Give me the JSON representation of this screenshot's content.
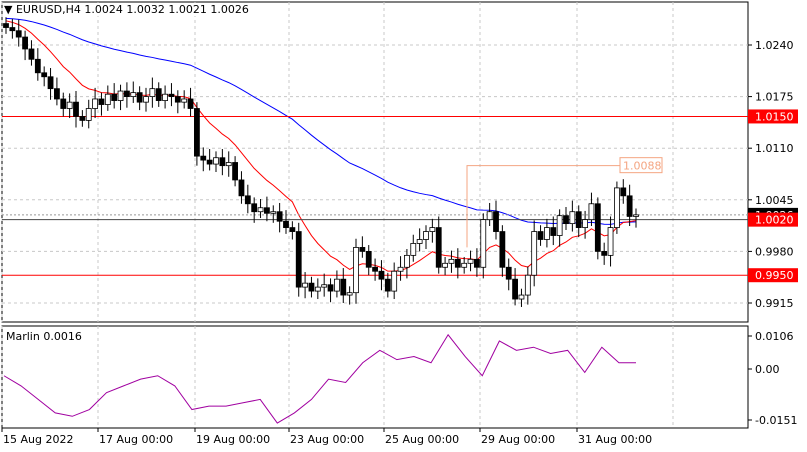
{
  "header": {
    "symbol": "EURUSD,H4",
    "open": "1.0024",
    "high": "1.0032",
    "low": "1.0021",
    "close": "1.0026"
  },
  "price_axis": [
    "1.0240",
    "1.0175",
    "1.0110",
    "1.0045",
    "0.9980",
    "0.9915"
  ],
  "price_axis_values": [
    1.024,
    1.0175,
    1.011,
    1.0045,
    0.998,
    0.9915
  ],
  "levels": [
    {
      "value": 1.015,
      "label": "1.0150",
      "color": "#ff0000"
    },
    {
      "value": 0.995,
      "label": "0.9950",
      "color": "#ff0000"
    },
    {
      "value": 1.002,
      "label": "1.0020",
      "color": "#ff0000"
    }
  ],
  "current_price": {
    "value": 1.0026,
    "label": "1.0026"
  },
  "annotation": {
    "value": 1.0088,
    "label": "1.0088",
    "color": "#f4a582"
  },
  "indicator": {
    "name": "Marlin",
    "value": "0.0016",
    "axis": [
      "0.0106",
      "0.00",
      "-0.0151"
    ],
    "axis_values": [
      0.0106,
      0,
      -0.0151
    ],
    "values": [
      -0.002,
      -0.005,
      -0.009,
      -0.013,
      -0.014,
      -0.012,
      -0.007,
      -0.005,
      -0.003,
      -0.002,
      -0.005,
      -0.012,
      -0.011,
      -0.011,
      -0.01,
      -0.009,
      -0.016,
      -0.013,
      -0.009,
      -0.003,
      -0.004,
      0.002,
      0.006,
      0.003,
      0.004,
      0.002,
      0.011,
      0.004,
      -0.002,
      0.009,
      0.006,
      0.007,
      0.005,
      0.006,
      -0.001,
      0.007,
      0.002,
      0.002
    ]
  },
  "time_axis": [
    "15 Aug 2022",
    "17 Aug 00:00",
    "19 Aug 00:00",
    "23 Aug 00:00",
    "25 Aug 00:00",
    "29 Aug 00:00",
    "31 Aug 00:00"
  ],
  "closes_pips": [
    262,
    258,
    250,
    235,
    222,
    205,
    200,
    185,
    172,
    160,
    168,
    150,
    145,
    160,
    172,
    165,
    178,
    170,
    182,
    175,
    180,
    168,
    175,
    185,
    170,
    178,
    175,
    168,
    172,
    160,
    100,
    95,
    90,
    98,
    88,
    92,
    70,
    50,
    40,
    30,
    35,
    28,
    30,
    18,
    10,
    5,
    -65,
    -60,
    -70,
    -65,
    -62,
    -70,
    -55,
    -75,
    -72,
    -15,
    -20,
    -40,
    -45,
    -55,
    -70,
    -45,
    -40,
    -25,
    -10,
    -5,
    5,
    10,
    -40,
    -35,
    -30,
    -40,
    -35,
    -30,
    -40,
    20,
    30,
    5,
    -40,
    -55,
    -80,
    -75,
    -50,
    5,
    -5,
    10,
    0,
    25,
    15,
    30,
    10,
    20,
    40,
    -20,
    -25,
    10,
    60,
    50,
    24,
    26
  ],
  "colors": {
    "bg": "#ffffff",
    "grid": "#c8c8c8",
    "bull": "#ffffff",
    "bear": "#000000",
    "fast_ma": "#ff0000",
    "slow_ma": "#0000ff",
    "osc": "#a000a0"
  }
}
